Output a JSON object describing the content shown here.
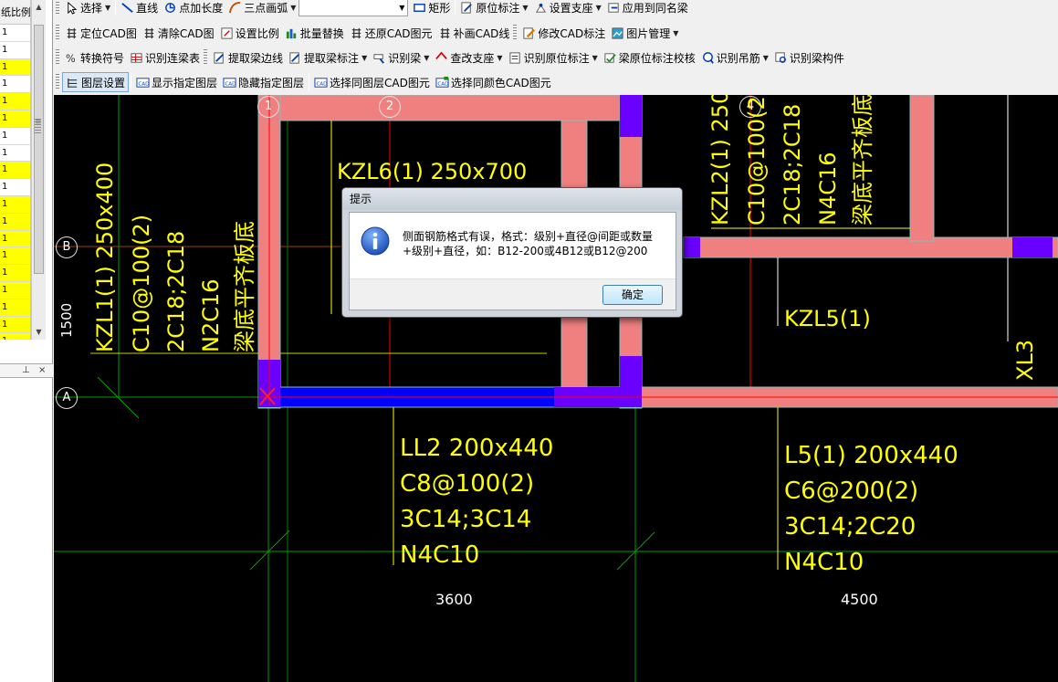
{
  "left_panel": {
    "table_header": "纸比例",
    "rows": [
      {
        "value": "1",
        "highlight": false
      },
      {
        "value": "1",
        "highlight": false
      },
      {
        "value": "1",
        "highlight": true
      },
      {
        "value": "1",
        "highlight": false
      },
      {
        "value": "1",
        "highlight": true
      },
      {
        "value": "1",
        "highlight": true
      },
      {
        "value": "1",
        "highlight": false
      },
      {
        "value": "1",
        "highlight": false
      },
      {
        "value": "1",
        "highlight": true
      },
      {
        "value": "1",
        "highlight": false
      },
      {
        "value": "1",
        "highlight": true
      },
      {
        "value": "1",
        "highlight": true
      },
      {
        "value": "1",
        "highlight": true
      },
      {
        "value": "1",
        "highlight": true
      },
      {
        "value": "1",
        "highlight": true
      },
      {
        "value": "1",
        "highlight": true
      },
      {
        "value": "1",
        "highlight": true
      },
      {
        "value": "1",
        "highlight": true
      },
      {
        "value": "1",
        "highlight": true
      }
    ],
    "highlight_color": "#ffff00",
    "panel2_pin": "⊥",
    "panel2_close": "×"
  },
  "toolbar": {
    "row1": {
      "select_label": "选择",
      "line_label": "直线",
      "point_length_label": "点加长度",
      "arc_label": "三点画弧",
      "arc_combo_value": "",
      "rect_label": "矩形",
      "in_situ_label": "原位标注",
      "support_label": "设置支座",
      "apply_same_label": "应用到同名梁"
    },
    "row2": {
      "locate_cad": "定位CAD图",
      "clear_cad": "清除CAD图",
      "set_scale": "设置比例",
      "batch_replace": "批量替换",
      "restore_cad": "还原CAD图元",
      "patch_cad_line": "补画CAD线",
      "modify_cad_label": "修改CAD标注",
      "image_manage": "图片管理"
    },
    "row3": {
      "convert_symbol": "转换符号",
      "identify_continuous": "识别连梁表",
      "extract_edge": "提取梁边线",
      "extract_label": "提取梁标注",
      "identify_beam": "识别梁",
      "check_support": "查改支座",
      "identify_in_situ": "识别原位标注",
      "check_in_situ": "梁原位标注校核",
      "identify_hanger": "识别吊筋",
      "identify_member": "识别梁构件"
    },
    "row4": {
      "layer_settings": "图层设置",
      "show_layer": "显示指定图层",
      "hide_layer": "隐藏指定图层",
      "select_same_layer": "选择同图层CAD图元",
      "select_same_color": "选择同颜色CAD图元"
    }
  },
  "drawing": {
    "axis_labels": {
      "a1": "1",
      "a2": "2",
      "a4": "4",
      "aB": "B",
      "aA": "A"
    },
    "beam_labels": {
      "kzl6": "KZL6(1) 250x700",
      "kzl1_line1": "KZL1(1) 250x400",
      "kzl1_line2": "C10@100(2)",
      "kzl1_line3": "2C18;2C18",
      "kzl1_line4": "N2C16",
      "kzl1_line5": "梁底平齐板底",
      "kzl2_line1": "KZL2(1) 250",
      "kzl2_line2": "C10@100(2",
      "kzl2_line3": "2C18;2C18",
      "kzl2_line4": "N4C16",
      "kzl2_line5": "梁底平齐板底",
      "kzl5": "KZL5(1)",
      "xl3": "XL3",
      "ll2_line1": "LL2 200x440",
      "ll2_line2": "C8@100(2)",
      "ll2_line3": "3C14;3C14",
      "ll2_line4": "N4C10",
      "l5_line1": "L5(1) 200x440",
      "l5_line2": "C6@200(2)",
      "l5_line3": "3C14;2C20",
      "l5_line4": "N4C10"
    },
    "dimensions": {
      "d1500": "1500",
      "d3600": "3600",
      "d4500": "4500"
    },
    "colors": {
      "background": "#000000",
      "beam_fill": "#f08080",
      "beam_border": "#80c0c0",
      "support_blue": "#0000ff",
      "support_purple": "#6a00ff",
      "text_yellow": "#ffff00",
      "axis_green": "#00a000",
      "axis_red": "#ff0000"
    }
  },
  "dialog": {
    "title": "提示",
    "icon": "info-icon",
    "message": "侧面钢筋格式有误，格式：级别+直径@间距或数量+级别+直径，如：B12-200或4B12或B12@200",
    "ok_label": "确定"
  }
}
